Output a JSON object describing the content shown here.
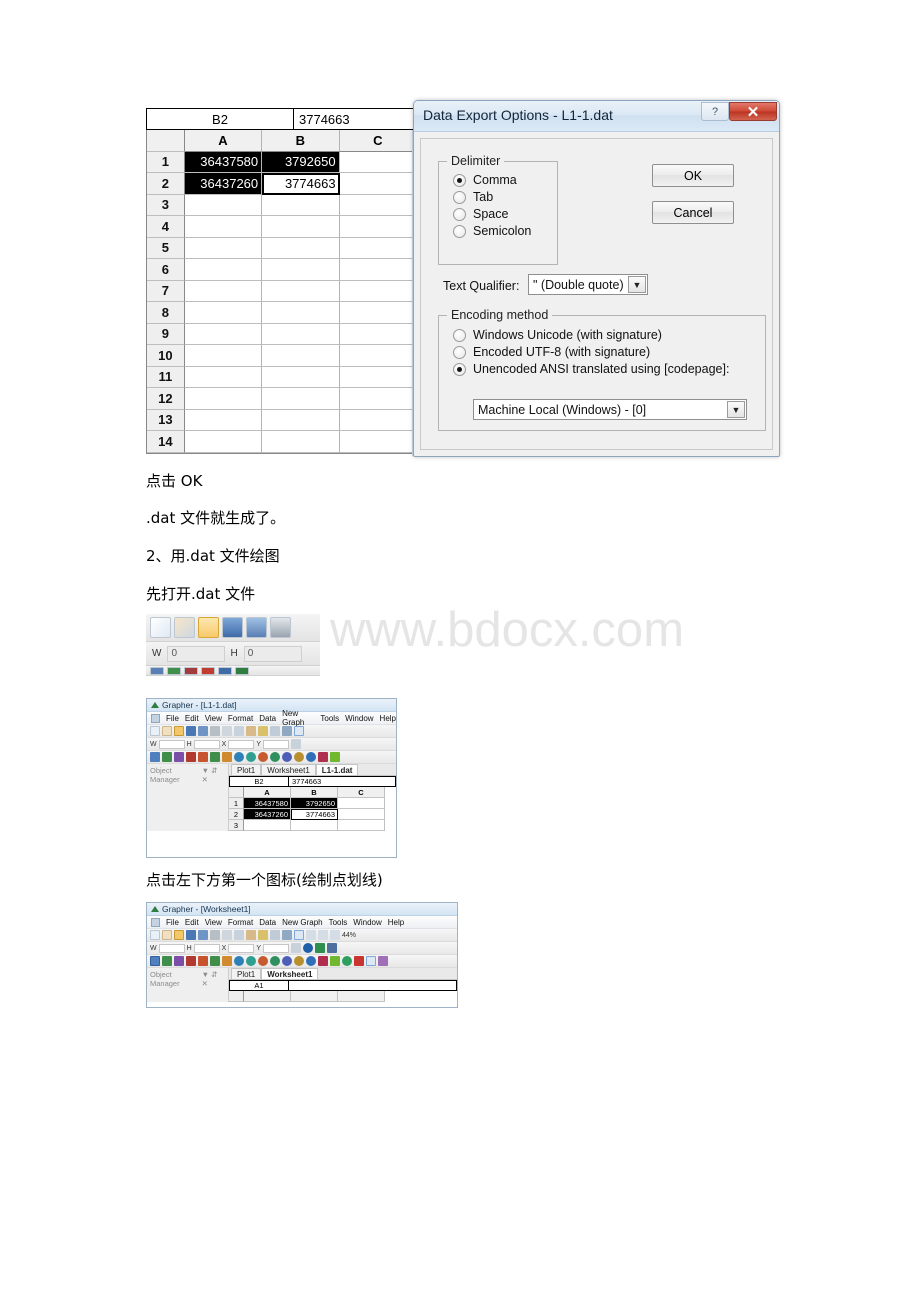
{
  "watermark": "www.bdocx.com",
  "spreadsheet": {
    "name_box": "B2",
    "formula_value": "3774663",
    "column_headers": [
      "A",
      "B",
      "C"
    ],
    "rows": [
      {
        "num": "1",
        "a": "36437580",
        "b": "3792650",
        "c": ""
      },
      {
        "num": "2",
        "a": "36437260",
        "b": "3774663",
        "c": ""
      },
      {
        "num": "3",
        "a": "",
        "b": "",
        "c": ""
      },
      {
        "num": "4",
        "a": "",
        "b": "",
        "c": ""
      },
      {
        "num": "5",
        "a": "",
        "b": "",
        "c": ""
      },
      {
        "num": "6",
        "a": "",
        "b": "",
        "c": ""
      },
      {
        "num": "7",
        "a": "",
        "b": "",
        "c": ""
      },
      {
        "num": "8",
        "a": "",
        "b": "",
        "c": ""
      },
      {
        "num": "9",
        "a": "",
        "b": "",
        "c": ""
      },
      {
        "num": "10",
        "a": "",
        "b": "",
        "c": ""
      },
      {
        "num": "11",
        "a": "",
        "b": "",
        "c": ""
      },
      {
        "num": "12",
        "a": "",
        "b": "",
        "c": ""
      },
      {
        "num": "13",
        "a": "",
        "b": "",
        "c": ""
      },
      {
        "num": "14",
        "a": "",
        "b": "",
        "c": ""
      }
    ]
  },
  "dialog": {
    "title": "Data Export Options - L1-1.dat",
    "help_button": "?",
    "close_button": "✕",
    "delimiter": {
      "legend": "Delimiter",
      "options": [
        {
          "label": "Comma",
          "selected": true
        },
        {
          "label": "Tab",
          "selected": false
        },
        {
          "label": "Space",
          "selected": false
        },
        {
          "label": "Semicolon",
          "selected": false
        }
      ]
    },
    "text_qualifier": {
      "label": "Text Qualifier:",
      "value": "\" (Double quote)",
      "arrow": "▼"
    },
    "encoding": {
      "legend": "Encoding method",
      "options": [
        {
          "label": "Windows Unicode (with signature)",
          "selected": false
        },
        {
          "label": "Encoded UTF-8 (with signature)",
          "selected": false
        },
        {
          "label": "Unencoded ANSI translated using [codepage]:",
          "selected": true
        }
      ],
      "codepage_value": "Machine Local (Windows) - [0]",
      "codepage_arrow": "▼"
    },
    "ok_label": "OK",
    "cancel_label": "Cancel"
  },
  "paragraphs": [
    {
      "text": "点击 OK"
    },
    {
      "text": ".dat 文件就生成了。"
    },
    {
      "text": "2、用.dat 文件绘图"
    },
    {
      "text": "先打开.dat 文件"
    },
    {
      "text": "点击左下方第一个图标(绘制点划线)"
    }
  ],
  "toolbar_strip": {
    "icons": [
      "new-document",
      "new-worksheet",
      "open-folder",
      "save",
      "export",
      "print"
    ],
    "width_label": "W",
    "width_value": "0",
    "height_label": "H",
    "height_value": "0"
  },
  "grapher_shot_1": {
    "title": "Grapher - [L1-1.dat]",
    "menu": [
      "File",
      "Edit",
      "View",
      "Format",
      "Data",
      "New Graph",
      "Tools",
      "Window",
      "Help"
    ],
    "fields": [
      {
        "label": "W",
        "value": "0"
      },
      {
        "label": "H",
        "value": "0"
      },
      {
        "label": "X",
        "value": "0"
      },
      {
        "label": "Y",
        "value": "0"
      }
    ],
    "object_manager": "Object Manager",
    "om_buttons": "▼ ⇵ ✕",
    "tabs": [
      {
        "label": "Plot1",
        "active": false
      },
      {
        "label": "Worksheet1",
        "active": false
      },
      {
        "label": "L1-1.dat",
        "active": true
      }
    ],
    "name_box": "B2",
    "formula_value": "3774663",
    "column_headers": [
      "A",
      "B",
      "C"
    ],
    "rows": [
      {
        "num": "1",
        "a": "36437580",
        "b": "3792650",
        "c": ""
      },
      {
        "num": "2",
        "a": "36437260",
        "b": "3774663",
        "c": ""
      },
      {
        "num": "3",
        "a": "",
        "b": "",
        "c": ""
      }
    ]
  },
  "grapher_shot_2": {
    "title": "Grapher - [Worksheet1]",
    "menu": [
      "File",
      "Edit",
      "View",
      "Format",
      "Data",
      "New Graph",
      "Tools",
      "Window",
      "Help"
    ],
    "zoom_value": "44%",
    "fields": [
      {
        "label": "W",
        "value": "0"
      },
      {
        "label": "H",
        "value": "0"
      },
      {
        "label": "X",
        "value": "0"
      },
      {
        "label": "Y",
        "value": "0"
      }
    ],
    "object_manager": "Object Manager",
    "om_buttons": "▼ ⇵ ✕",
    "tabs": [
      {
        "label": "Plot1",
        "active": false
      },
      {
        "label": "Worksheet1",
        "active": true
      }
    ],
    "name_box": "A1",
    "formula_value": ""
  }
}
